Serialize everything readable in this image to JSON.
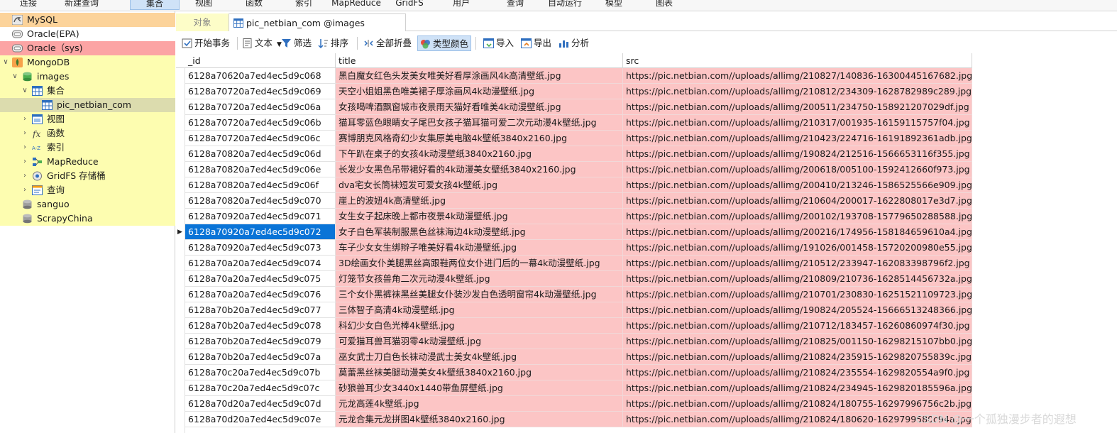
{
  "ribbon": {
    "items": [
      "连接",
      "新建查询",
      "集合",
      "视图",
      "函数",
      "索引",
      "MapReduce",
      "GridFS",
      "用户",
      "查询",
      "自动运行",
      "模型",
      "图表"
    ]
  },
  "sidebar": {
    "items": [
      {
        "label": "MySQL",
        "icon": "dolphin-icon"
      },
      {
        "label": "Oracle(EPA)",
        "icon": "database-icon"
      },
      {
        "label": "Oracle（sys)",
        "icon": "database-icon"
      },
      {
        "label": "MongoDB",
        "icon": "mongodb-leaf-icon"
      },
      {
        "label": "images",
        "icon": "database-stack-icon"
      },
      {
        "label": "集合",
        "icon": "table-icon"
      },
      {
        "label": "pic_netbian_com",
        "icon": "table-icon"
      },
      {
        "label": "视图",
        "icon": "view-icon"
      },
      {
        "label": "函数",
        "icon": "function-icon"
      },
      {
        "label": "索引",
        "icon": "index-icon"
      },
      {
        "label": "MapReduce",
        "icon": "mapreduce-icon"
      },
      {
        "label": "GridFS 存储桶",
        "icon": "gridfs-icon"
      },
      {
        "label": "查询",
        "icon": "query-icon"
      },
      {
        "label": "sanguo",
        "icon": "database-stack-icon"
      },
      {
        "label": "ScrapyChina",
        "icon": "database-stack-icon"
      }
    ]
  },
  "tabs": {
    "objects": "对象",
    "active": "pic_netbian_com @images (MongoD..."
  },
  "toolbar": {
    "begin_tx": "开始事务",
    "text": "文本",
    "filter": "筛选",
    "sort": "排序",
    "collapse_all": "全部折叠",
    "type_color": "类型颜色",
    "import": "导入",
    "export": "导出",
    "analyze": "分析"
  },
  "grid": {
    "columns": [
      "_id",
      "title",
      "src"
    ],
    "rows": [
      [
        "6128a70620a7ed4ec5d9c068",
        "黑白魔女红色头发美女唯美好看厚涂画风4k高清壁纸.jpg",
        "https://pic.netbian.com//uploads/allimg/210827/140836-16300445167682.jpg"
      ],
      [
        "6128a70720a7ed4ec5d9c069",
        "天空小姐姐黑色唯美裙子厚涂画风4k动漫壁纸.jpg",
        "https://pic.netbian.com//uploads/allimg/210812/234309-1628782989c289.jpg"
      ],
      [
        "6128a70720a7ed4ec5d9c06a",
        "女孩喝啤酒飘窗城市夜景雨天猫好看唯美4k动漫壁纸.jpg",
        "https://pic.netbian.com//uploads/allimg/200511/234750-158921207029df.jpg"
      ],
      [
        "6128a70720a7ed4ec5d9c06b",
        "猫耳零蓝色眼睛女子尾巴女孩子猫耳猫可爱二次元动漫4k壁纸.jpg",
        "https://pic.netbian.com//uploads/allimg/210317/001935-16159115757f04.jpg"
      ],
      [
        "6128a70720a7ed4ec5d9c06c",
        "赛博朋克风格奇幻少女集原美电脑4k壁纸3840x2160.jpg",
        "https://pic.netbian.com//uploads/allimg/210423/224716-16191892361adb.jpg"
      ],
      [
        "6128a70820a7ed4ec5d9c06d",
        "下午趴在桌子的女孩4k动漫壁纸3840x2160.jpg",
        "https://pic.netbian.com//uploads/allimg/190824/212516-1566653116f355.jpg"
      ],
      [
        "6128a70820a7ed4ec5d9c06e",
        "长发少女黑色吊带裙好看的4k动漫美女壁纸3840x2160.jpg",
        "https://pic.netbian.com//uploads/allimg/200618/005100-1592412660f973.jpg"
      ],
      [
        "6128a70820a7ed4ec5d9c06f",
        "dva宅女长筒袜短发可爱女孩4k壁纸.jpg",
        "https://pic.netbian.com//uploads/allimg/200410/213246-1586525566e909.jpg"
      ],
      [
        "6128a70820a7ed4ec5d9c070",
        "崖上的波妞4k高清壁纸.jpg",
        "https://pic.netbian.com//uploads/allimg/210604/200017-1622808017e3d7.jpg"
      ],
      [
        "6128a70920a7ed4ec5d9c071",
        "女生女子起床晚上都市夜景4k动漫壁纸.jpg",
        "https://pic.netbian.com//uploads/allimg/200102/193708-15779650288588.jpg"
      ],
      [
        "6128a70920a7ed4ec5d9c072",
        "女子白色军装制服黑色丝袜海边4k动漫壁纸.jpg",
        "https://pic.netbian.com//uploads/allimg/200216/174956-158184659610a4.jpg"
      ],
      [
        "6128a70920a7ed4ec5d9c073",
        "车子少女女生绑辫子唯美好看4k动漫壁纸.jpg",
        "https://pic.netbian.com//uploads/allimg/191026/001458-15720200980e55.jpg"
      ],
      [
        "6128a70a20a7ed4ec5d9c074",
        "3D绘画女仆美腿黑丝高跟鞋两位女仆进门后的一幕4k动漫壁纸.jpg",
        "https://pic.netbian.com//uploads/allimg/210512/233947-162083398796f2.jpg"
      ],
      [
        "6128a70a20a7ed4ec5d9c075",
        "灯笼节女孩兽角二次元动漫4k壁纸.jpg",
        "https://pic.netbian.com//uploads/allimg/210809/210736-1628514456732a.jpg"
      ],
      [
        "6128a70a20a7ed4ec5d9c076",
        "三个女仆黑裤袜黑丝美腿女仆装沙发白色透明窗帘4k动漫壁纸.jpg",
        "https://pic.netbian.com//uploads/allimg/210701/230830-16251521109723.jpg"
      ],
      [
        "6128a70b20a7ed4ec5d9c077",
        "三体智子高清4k动漫壁纸.jpg",
        "https://pic.netbian.com//uploads/allimg/190824/205524-15666513248366.jpg"
      ],
      [
        "6128a70b20a7ed4ec5d9c078",
        "科幻少女白色光棒4k壁纸.jpg",
        "https://pic.netbian.com//uploads/allimg/210712/183457-16260860974f30.jpg"
      ],
      [
        "6128a70b20a7ed4ec5d9c079",
        "可爱猫耳兽耳猫羽零4k动漫壁纸.jpg",
        "https://pic.netbian.com//uploads/allimg/210825/001150-16298215107bb0.jpg"
      ],
      [
        "6128a70b20a7ed4ec5d9c07a",
        "巫女武士刀白色长袜动漫武士美女4k壁纸.jpg",
        "https://pic.netbian.com//uploads/allimg/210824/235915-1629820755839c.jpg"
      ],
      [
        "6128a70c20a7ed4ec5d9c07b",
        "莫蕾黑丝袜美腿动漫美女4k壁纸3840x2160.jpg",
        "https://pic.netbian.com//uploads/allimg/210824/235554-1629820554a9f0.jpg"
      ],
      [
        "6128a70c20a7ed4ec5d9c07c",
        "砂狼兽耳少女3440x1440带鱼屏壁纸.jpg",
        "https://pic.netbian.com//uploads/allimg/210824/234945-1629820185596a.jpg"
      ],
      [
        "6128a70d20a7ed4ec5d9c07d",
        "元龙高莲4k壁纸.jpg",
        "https://pic.netbian.com//uploads/allimg/210824/180755-16297996756c2b.jpg"
      ],
      [
        "6128a70d20a7ed4ec5d9c07e",
        "元龙合集元龙拼图4k壁纸3840x2160.jpg",
        "https://pic.netbian.com//uploads/allimg/210824/180620-1629799580c94a.jpg"
      ]
    ],
    "selected_row": 10
  },
  "watermark": "CSDN @一个孤独漫步者的遐想"
}
